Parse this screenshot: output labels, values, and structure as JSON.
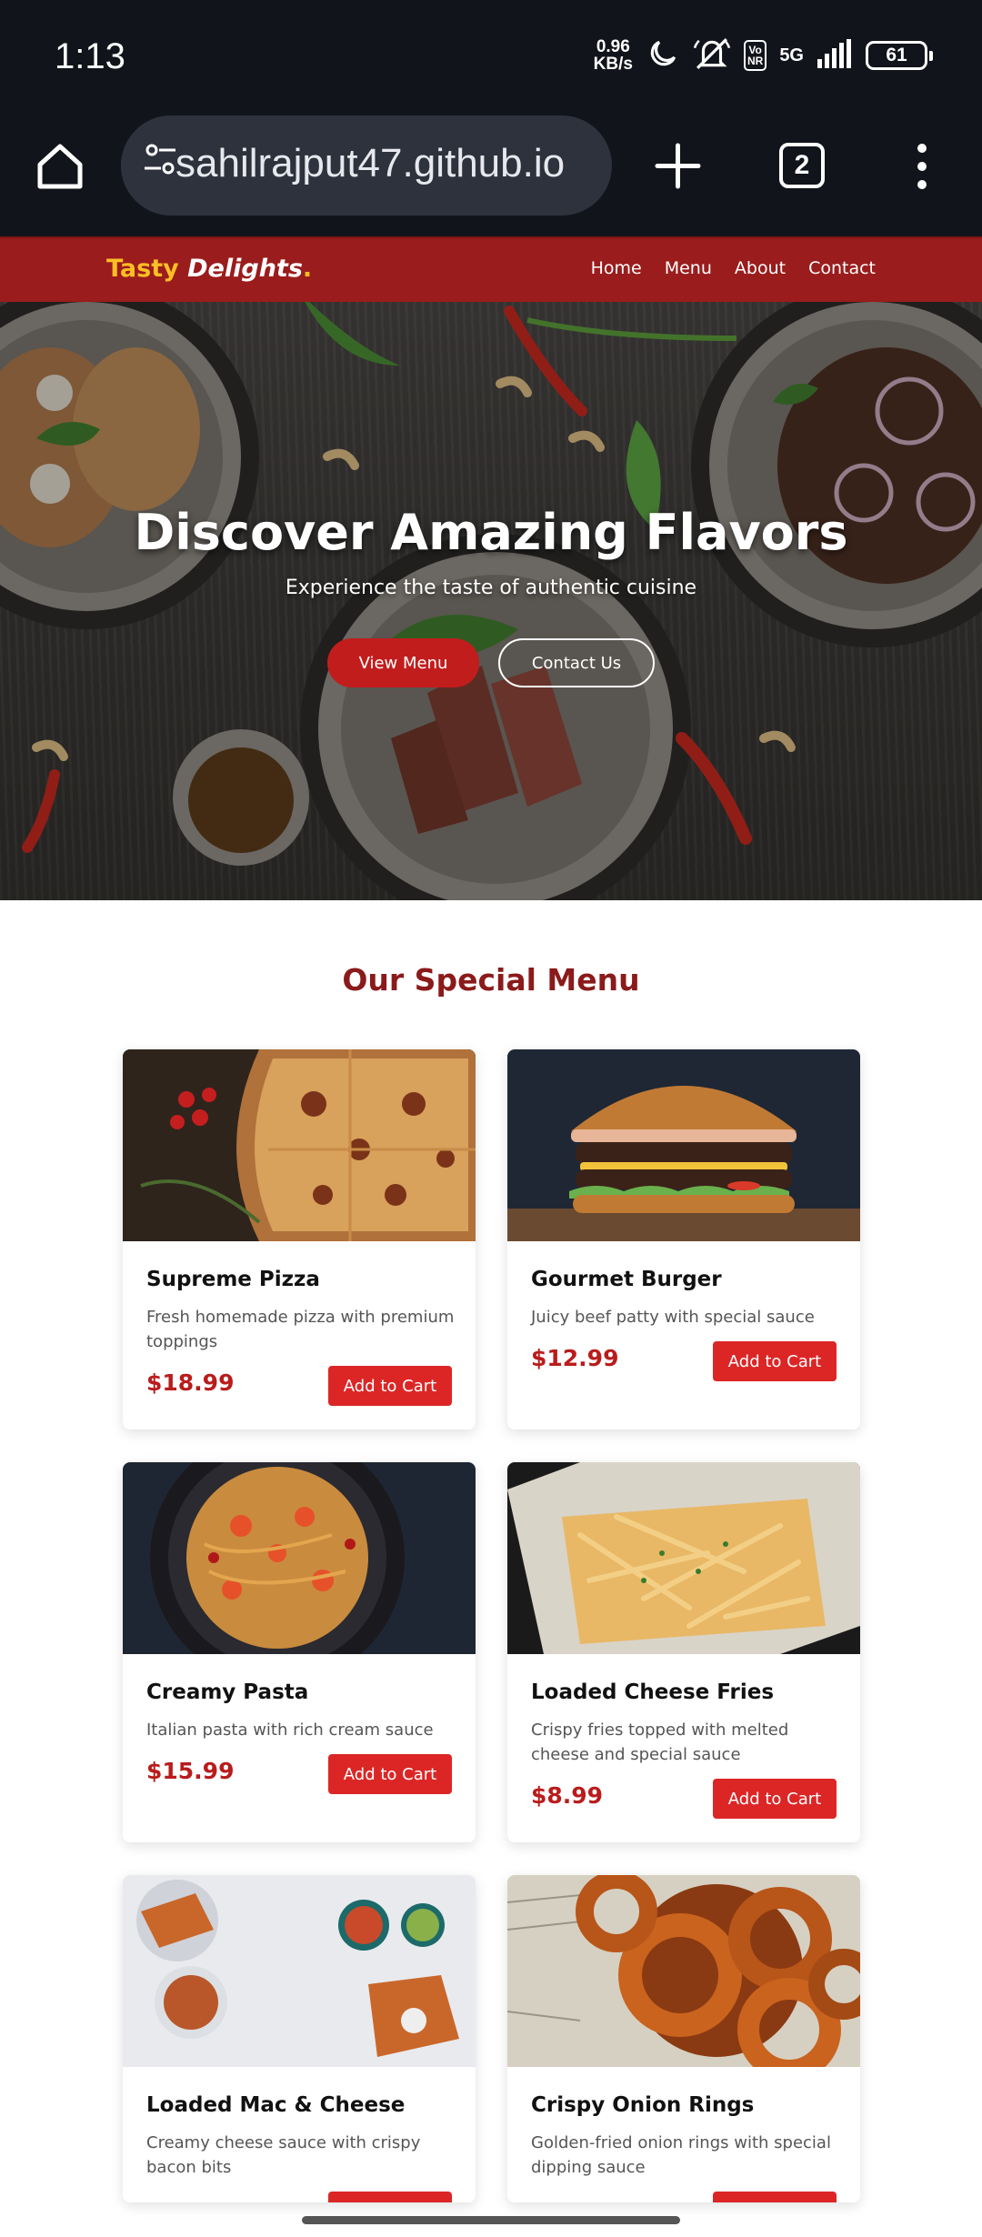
{
  "status_bar": {
    "time": "1:13",
    "net_speed_value": "0.96",
    "net_speed_unit": "KB/s",
    "network": "5G",
    "volte_top": "Vo",
    "volte_bottom": "NR",
    "battery": "61",
    "icons": [
      "moon-icon",
      "mute-icon",
      "volte-icon",
      "signal-icon",
      "battery-icon"
    ]
  },
  "browser": {
    "url": "sahilrajput47.github.io",
    "tab_count": "2",
    "icons": [
      "home-icon",
      "site-settings-icon",
      "new-tab-icon",
      "tab-switcher-icon",
      "overflow-menu-icon"
    ]
  },
  "site": {
    "logo_part1": "Tasty ",
    "logo_part2": "Delights",
    "logo_dot": ".",
    "nav": [
      "Home",
      "Menu",
      "About",
      "Contact"
    ]
  },
  "hero": {
    "title": "Discover Amazing Flavors",
    "subtitle": "Experience the taste of authentic cuisine",
    "primary_button": "View Menu",
    "secondary_button": "Contact Us"
  },
  "menu": {
    "title": "Our Special Menu",
    "items": [
      {
        "name": "Supreme Pizza",
        "description": "Fresh homemade pizza with premium toppings",
        "price": "$18.99",
        "button": "Add to Cart",
        "image": "pizza"
      },
      {
        "name": "Gourmet Burger",
        "description": "Juicy beef patty with special sauce",
        "price": "$12.99",
        "button": "Add to Cart",
        "image": "burger"
      },
      {
        "name": "Creamy Pasta",
        "description": "Italian pasta with rich cream sauce",
        "price": "$15.99",
        "button": "Add to Cart",
        "image": "pasta"
      },
      {
        "name": "Loaded Cheese Fries",
        "description": "Crispy fries topped with melted cheese and special sauce",
        "price": "$8.99",
        "button": "Add to Cart",
        "image": "fries"
      },
      {
        "name": "Loaded Mac & Cheese",
        "description": "Creamy cheese sauce with crispy bacon bits",
        "price": "",
        "button": "",
        "image": "mac-cheese"
      },
      {
        "name": "Crispy Onion Rings",
        "description": "Golden-fried onion rings with special dipping sauce",
        "price": "",
        "button": "",
        "image": "onion-rings"
      }
    ]
  },
  "colors": {
    "header_red": "#9b1c1c",
    "button_red": "#dc2626",
    "price_red": "#b91c1c",
    "title_red": "#8b1a1a",
    "logo_yellow": "#fbbf24",
    "browser_dark": "#12141b"
  }
}
